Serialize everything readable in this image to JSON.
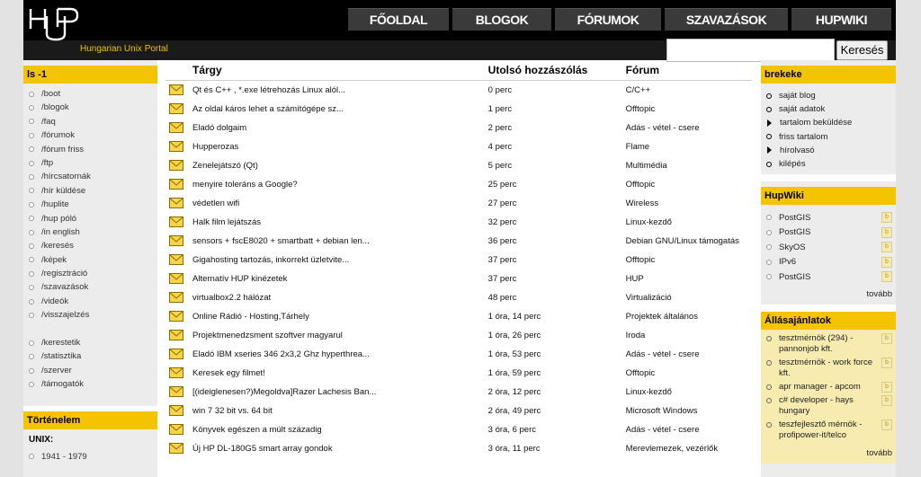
{
  "header": {
    "logo_text": "HUP",
    "tagline": "Hungarian Unix Portal",
    "nav": [
      "FŐOLDAL",
      "BLOGOK",
      "FÓRUMOK",
      "SZAVAZÁSOK",
      "HUPWIKI"
    ],
    "search_button": "Keresés",
    "search_value": ""
  },
  "left": {
    "title": "ls -1",
    "items": [
      "/boot",
      "/blogok",
      "/faq",
      "/fórumok",
      "/fórum friss",
      "/ftp",
      "/hírcsatornák",
      "/hír küldése",
      "/huplite",
      "/hup póló",
      "/in english",
      "/keresés",
      "/képek",
      "/regisztráció",
      "/szavazások",
      "/videók",
      "/visszajelzés"
    ],
    "items2": [
      "/kerestetik",
      "/statisztika",
      "/szerver",
      "/támogatók"
    ],
    "history_title": "Történelem",
    "history_section": "UNIX:",
    "history_item": "1941 - 1979"
  },
  "main": {
    "columns": [
      "Tárgy",
      "Utolsó hozzászólás",
      "Fórum"
    ],
    "rows": [
      {
        "subject": "Qt és C++ , *.exe létrehozás Linux alól...",
        "last": "0 perc",
        "forum": "C/C++"
      },
      {
        "subject": "Az oldal káros lehet a számítógépe sz...",
        "last": "1 perc",
        "forum": "Offtopic"
      },
      {
        "subject": "Eladó dolgaim",
        "last": "2 perc",
        "forum": "Adás - vétel - csere"
      },
      {
        "subject": "Hupperozas",
        "last": "4 perc",
        "forum": "Flame"
      },
      {
        "subject": "Zenelejátszó (Qt)",
        "last": "5 perc",
        "forum": "Multimédia"
      },
      {
        "subject": "menyire toleráns a Google?",
        "last": "25 perc",
        "forum": "Offtopic"
      },
      {
        "subject": "védetlen wifi",
        "last": "27 perc",
        "forum": "Wireless"
      },
      {
        "subject": "Halk film lejátszás",
        "last": "32 perc",
        "forum": "Linux-kezdő"
      },
      {
        "subject": "sensors + fscE8020 + smartbatt + debian len...",
        "last": "36 perc",
        "forum": "Debian GNU/Linux támogatás"
      },
      {
        "subject": "Gigahosting tartozás, inkorrekt üzletvite...",
        "last": "37 perc",
        "forum": "Offtopic"
      },
      {
        "subject": "Alternatív HUP kinézetek",
        "last": "37 perc",
        "forum": "HUP"
      },
      {
        "subject": "virtualbox2.2 hálózat",
        "last": "48 perc",
        "forum": "Virtualizáció"
      },
      {
        "subject": "Online Rádió - Hosting,Tárhely",
        "last": "1 óra, 14 perc",
        "forum": "Projektek általános"
      },
      {
        "subject": "Projektmenedzsment szoftver magyarul",
        "last": "1 óra, 26 perc",
        "forum": "Iroda"
      },
      {
        "subject": "Eladó IBM xseries 346 2x3,2 Ghz hyperthrea...",
        "last": "1 óra, 53 perc",
        "forum": "Adás - vétel - csere"
      },
      {
        "subject": "Keresek egy filmet!",
        "last": "1 óra, 59 perc",
        "forum": "Offtopic"
      },
      {
        "subject": "[(ideiglenesen?)Megoldva]Razer Lachesis Ban...",
        "last": "2 óra, 12 perc",
        "forum": "Linux-kezdő"
      },
      {
        "subject": "win 7 32 bit vs. 64 bit",
        "last": "2 óra, 49 perc",
        "forum": "Microsoft Windows"
      },
      {
        "subject": "Könyvek egészen a múlt századig",
        "last": "3 óra, 6 perc",
        "forum": "Adás - vétel - csere"
      },
      {
        "subject": "Új HP DL-180G5 smart array gondok",
        "last": "3 óra, 11 perc",
        "forum": "Merevlemezek, vezérlők"
      }
    ]
  },
  "right": {
    "user_title": "brekeke",
    "user_items": [
      {
        "label": "saját blog",
        "bullet": "circle"
      },
      {
        "label": "saját adatok",
        "bullet": "circle"
      },
      {
        "label": "tartalom beküldése",
        "bullet": "triangle"
      },
      {
        "label": "friss tartalom",
        "bullet": "circle"
      },
      {
        "label": "hírolvasó",
        "bullet": "triangle"
      },
      {
        "label": "kilépés",
        "bullet": "circle"
      }
    ],
    "wiki_title": "HupWiki",
    "wiki_items": [
      "PostGIS",
      "PostGIS",
      "SkyOS",
      "IPv6",
      "PostGIS"
    ],
    "wiki_more": "tovább",
    "jobs_title": "Állásajánlatok",
    "jobs_items": [
      "tesztmérnök (294) - pannonjob kft.",
      "tesztmérnök - work force kft.",
      "apr manager - apcom",
      "c# developer - hays hungary",
      "teszfejlesztő mérnök - profipower-it/telco"
    ],
    "jobs_more": "tovább",
    "rss_icon_label": "b"
  },
  "colors": {
    "accent": "#f5c400",
    "header_bg": "#000000",
    "nav_bg": "#3a3a3a",
    "jobs_bg": "#f7ebb0"
  }
}
